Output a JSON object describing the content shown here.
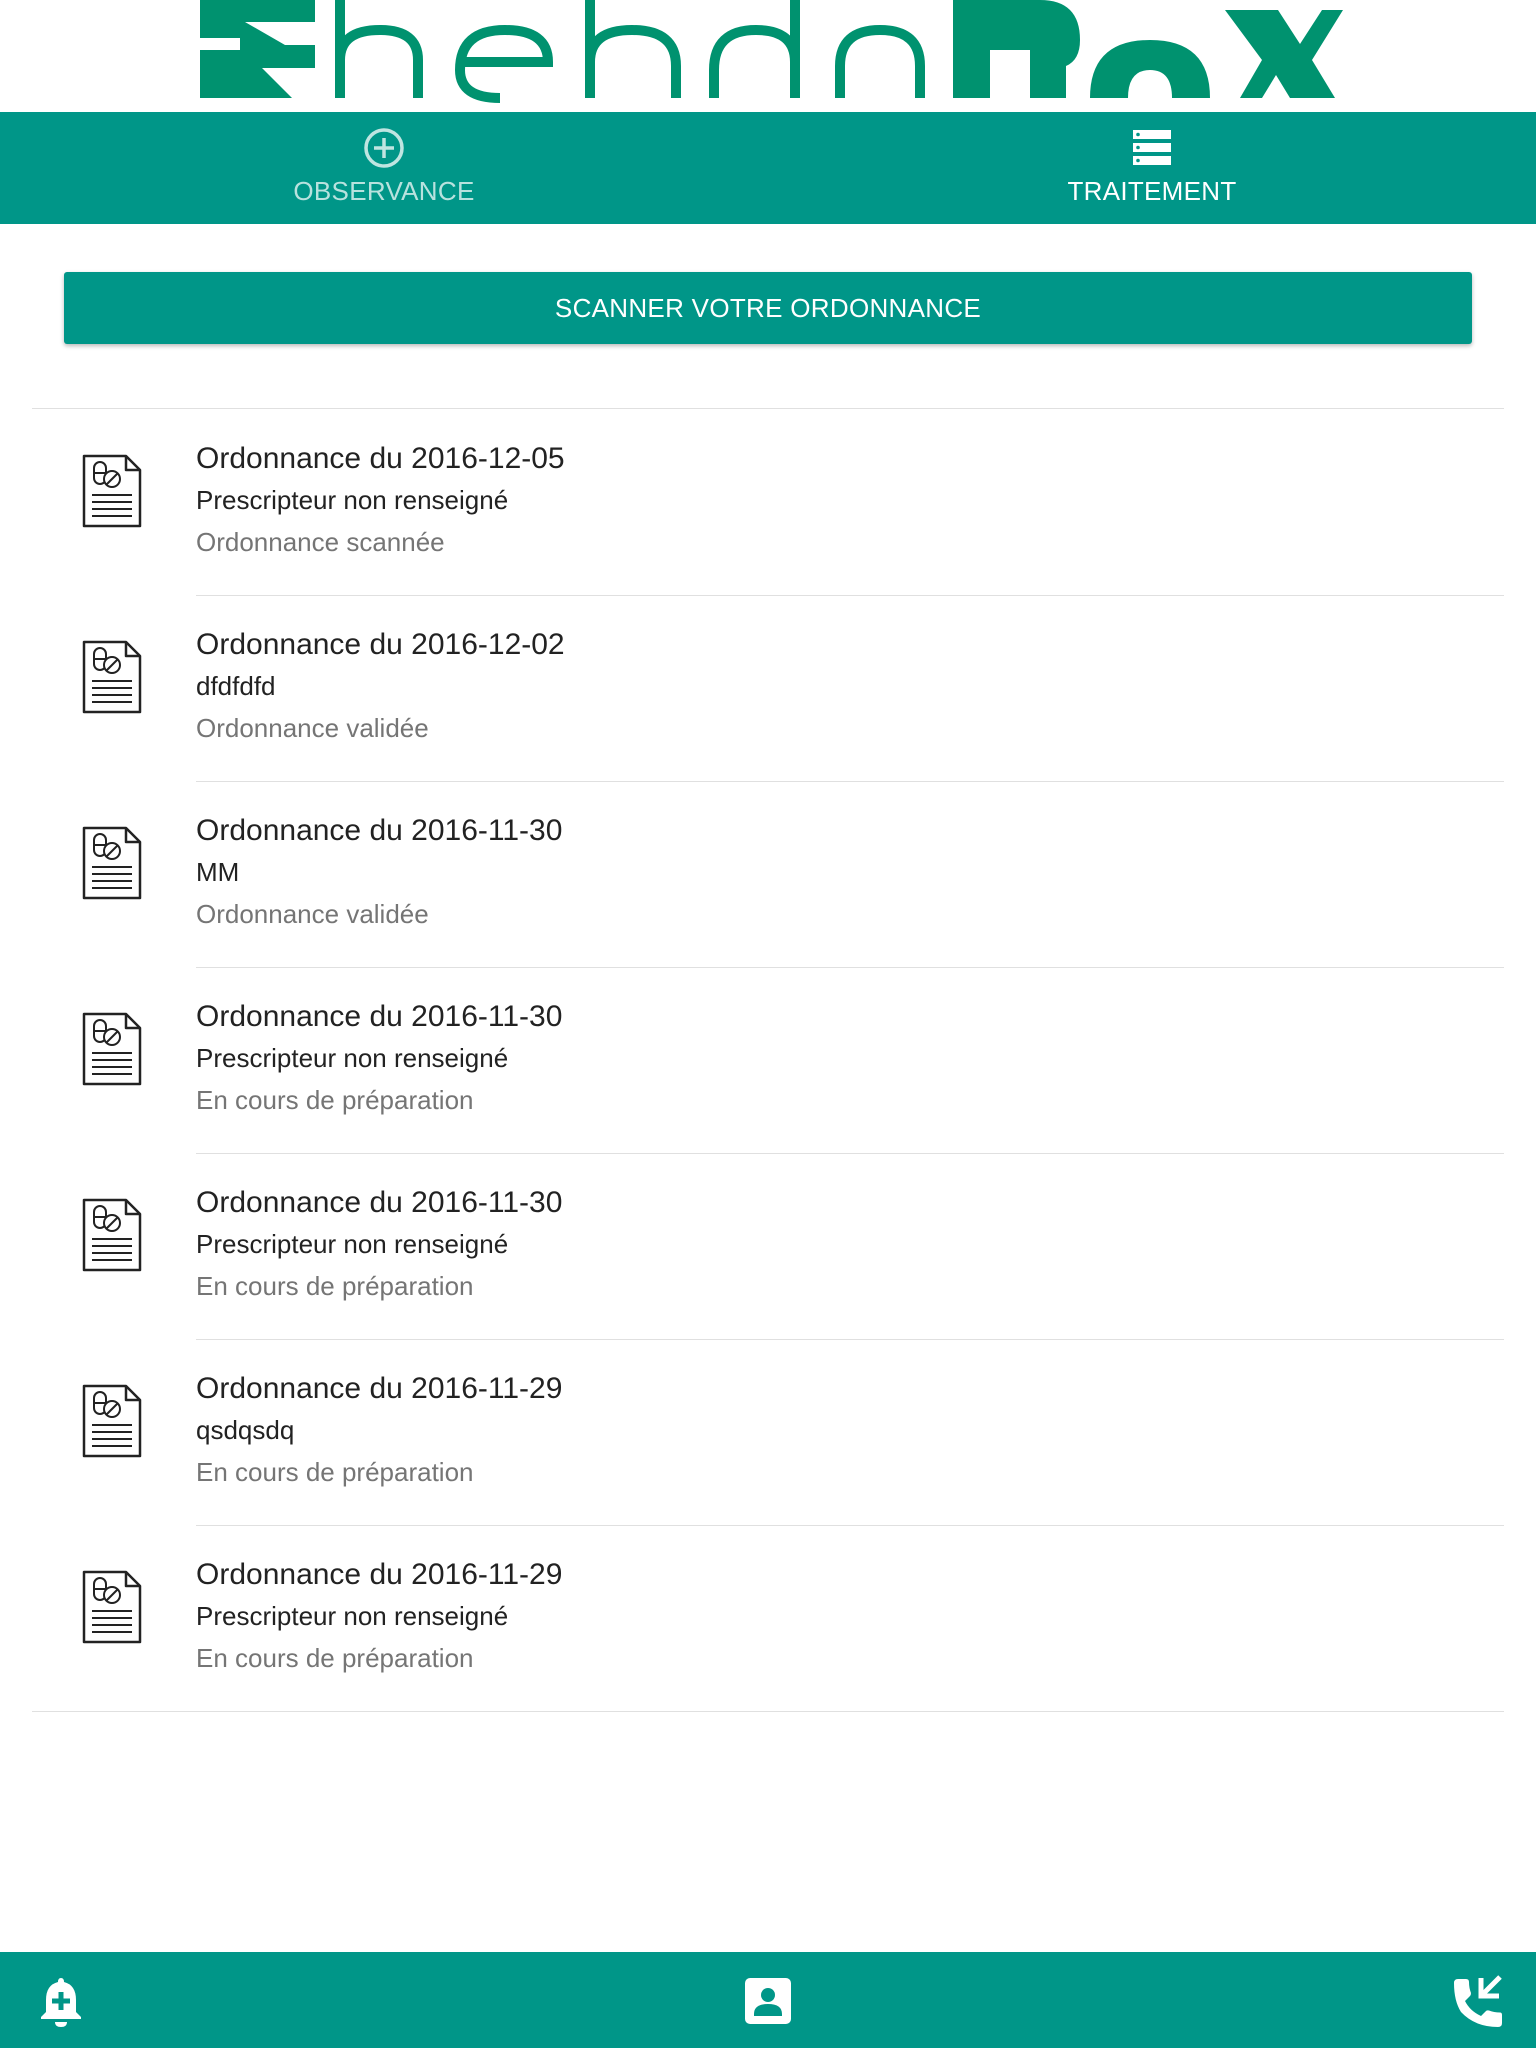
{
  "brand": {
    "logo_text": "HebdoBox",
    "colors": {
      "primary": "#009688",
      "logo_green": "#00926f"
    }
  },
  "tabs": [
    {
      "label": "OBSERVANCE",
      "icon": "plus-circle-icon",
      "active": false
    },
    {
      "label": "TRAITEMENT",
      "icon": "list-icon",
      "active": true
    }
  ],
  "scan_button": {
    "label": "SCANNER VOTRE ORDONNANCE"
  },
  "prescriptions": [
    {
      "title": "Ordonnance du 2016-12-05",
      "prescriber": "Prescripteur non renseigné",
      "status": "Ordonnance scannée"
    },
    {
      "title": "Ordonnance du 2016-12-02",
      "prescriber": "dfdfdfd",
      "status": "Ordonnance validée"
    },
    {
      "title": "Ordonnance du 2016-11-30",
      "prescriber": "MM",
      "status": "Ordonnance validée"
    },
    {
      "title": "Ordonnance du 2016-11-30",
      "prescriber": "Prescripteur non renseigné",
      "status": "En cours de préparation"
    },
    {
      "title": "Ordonnance du 2016-11-30",
      "prescriber": "Prescripteur non renseigné",
      "status": "En cours de préparation"
    },
    {
      "title": "Ordonnance du 2016-11-29",
      "prescriber": "qsdqsdq",
      "status": "En cours de préparation"
    },
    {
      "title": "Ordonnance du 2016-11-29",
      "prescriber": "Prescripteur non renseigné",
      "status": "En cours de préparation"
    }
  ],
  "bottom_bar": {
    "buttons": [
      {
        "icon": "medical-bell-icon"
      },
      {
        "icon": "contact-card-icon"
      },
      {
        "icon": "phone-icon"
      }
    ]
  }
}
